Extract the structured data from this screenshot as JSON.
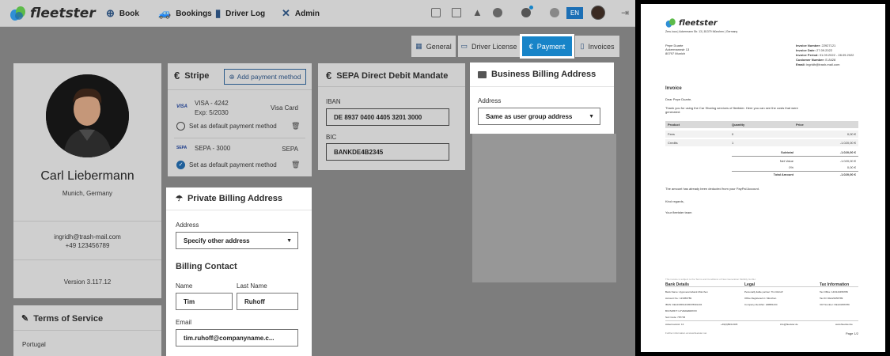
{
  "brand": {
    "name": "fleetster",
    "accent": "#1784c8"
  },
  "nav": {
    "items": [
      {
        "label": "Book",
        "icon": "plus-circle-icon"
      },
      {
        "label": "Bookings",
        "icon": "car-icon"
      },
      {
        "label": "Driver Log",
        "icon": "book-icon"
      },
      {
        "label": "Admin",
        "icon": "tools-icon"
      }
    ],
    "language": "EN"
  },
  "tabs": [
    {
      "label": "General",
      "active": false
    },
    {
      "label": "Driver License",
      "active": false
    },
    {
      "label": "Payment",
      "active": true
    },
    {
      "label": "Invoices",
      "active": false
    }
  ],
  "profile": {
    "name": "Carl Liebermann",
    "location": "Munich, Germany",
    "email": "ingridh@trash-mail.com",
    "phone": "+49 123456789",
    "version": "Version 3.117.12"
  },
  "terms": {
    "title": "Terms of Service",
    "item": "Portugal"
  },
  "stripe": {
    "title": "Stripe",
    "add_button": "Add payment method",
    "methods": [
      {
        "brand": "VISA",
        "name": "VISA - 4242",
        "type": "Visa Card",
        "expiry": "Exp: 5/2030",
        "default_label": "Set as default payment method",
        "is_default": false
      },
      {
        "brand": "SEPA",
        "name": "SEPA - 3000",
        "type": "SEPA",
        "expiry": "",
        "default_label": "Set as default payment method",
        "is_default": true
      }
    ]
  },
  "sepa": {
    "title": "SEPA Direct Debit Mandate",
    "iban_label": "IBAN",
    "iban": "DE 8937 0400 4405 3201 3000",
    "bic_label": "BIC",
    "bic": "BANKDE4B2345"
  },
  "business_billing": {
    "title": "Business Billing Address",
    "address_label": "Address",
    "address_value": "Same as user group address"
  },
  "private_billing": {
    "title": "Private Billing Address",
    "address_label": "Address",
    "address_value": "Specify other address",
    "contact_title": "Billing Contact",
    "name_label": "Name",
    "name_value": "Tim",
    "lastname_label": "Last Name",
    "lastname_value": "Ruhoff",
    "email_label": "Email",
    "email_value": "tim.ruhoff@companyname.c..."
  },
  "invoice": {
    "logo": "fleetster",
    "sender_line": "Zeru.ioca | Ackermann Str. 13 | 81379 München | Germany",
    "recipient": [
      "Pepe Duarte",
      "Ackermannstr 13",
      "80797 Munich"
    ],
    "meta": [
      {
        "label": "Invoice Number:",
        "value": "22927121"
      },
      {
        "label": "Invoice Date:",
        "value": "27.09.2022"
      },
      {
        "label": "Invoice Period:",
        "value": "01.09.2022 - 28.09.2022"
      },
      {
        "label": "Customer Number:",
        "value": "E-8428"
      },
      {
        "label": "Email:",
        "value": "ingridh@trash-mail.com"
      }
    ],
    "heading": "Invoice",
    "greeting": "Dear Pepe Duarte,",
    "intro": [
      "Thank you for using the Car Sharing services of fleetster. Here you can see the costs that were",
      "generated:"
    ],
    "columns": [
      "Product",
      "Quantity",
      "Price"
    ],
    "rows": [
      {
        "product": "Fees",
        "quantity": "0",
        "price": "0,00 €"
      },
      {
        "product": "Credits",
        "quantity": "1",
        "price": "-1.020,00 €"
      }
    ],
    "totals": [
      {
        "label": "Subtotal",
        "value": "-1.020,00 €",
        "bold": true
      },
      {
        "label": "Net Value",
        "value": "-1.020,00 €",
        "bold": false
      },
      {
        "label": "0%",
        "value": "0,00 €",
        "bold": false
      },
      {
        "label": "Total Amount",
        "value": "-1.020,00 €",
        "bold": true
      }
    ],
    "paid_note": "The amount has already been deducted from your PayPal Account.",
    "closing": "Kind regards,",
    "signature": "Your fleetster team",
    "footer": {
      "terms_note": "This invoice is subject to the Terms and Conditions of New Generation Mobility GmbH.",
      "bank_title": "Bank Details",
      "legal_title": "Legal",
      "tax_title": "Tax Information",
      "bank_lines": [
        "Bank Name: Hypovereinsbank München",
        "Account No.: 123456789",
        "IBAN: DE12345612345678901234",
        "BIC/SWIFT: HYVEDEMMXXX",
        "Sort Code: 787745"
      ],
      "legal_lines": [
        "Personally liable partner: Tim Ruhoff",
        "Office Registered in: München",
        "Company Identifier: HRB81234"
      ],
      "tax_lines": [
        "Tax Office: 143/123456789",
        "Tax ID: DE123456789",
        "VAT Number: DE123456789"
      ],
      "contact_items": [
        "Ackermannstr. 13",
        "+49(0)89/12345",
        "info@fleetster.de",
        "www.fleetster.de"
      ],
      "more_info": "Further information at www.fleetster.net",
      "page": "Page 1/2"
    }
  }
}
